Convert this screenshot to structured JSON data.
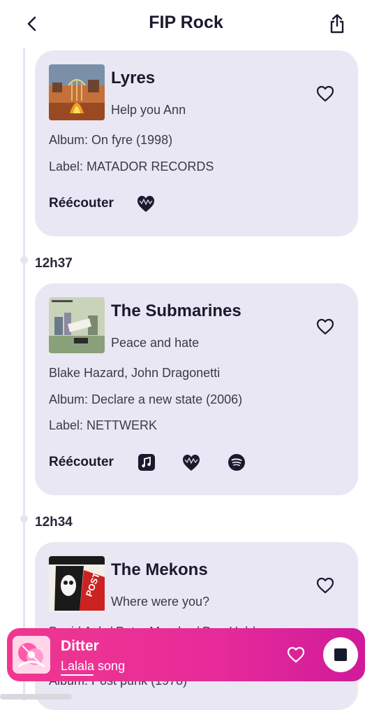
{
  "header": {
    "title": "FIP Rock"
  },
  "timeline": [
    {
      "time": "",
      "artist": "Lyres",
      "song": "Help you Ann",
      "meta": [
        "Album: On fyre (1998)",
        "Label: MATADOR RECORDS"
      ],
      "replay_label": "Réécouter",
      "services": [
        "deezer-icon"
      ]
    },
    {
      "time": "12h37",
      "artist": "The Submarines",
      "song": "Peace and hate",
      "meta": [
        "Blake Hazard, John Dragonetti",
        "Album: Declare a new state (2006)",
        "Label: NETTWERK"
      ],
      "replay_label": "Réécouter",
      "services": [
        "apple-music-icon",
        "deezer-icon",
        "spotify-icon"
      ]
    },
    {
      "time": "12h34",
      "artist": "The Mekons",
      "song": "Where were you?",
      "meta": [
        "David Ash / Peter Mender / Dan Hal /",
        "Album: Post punk (1978)"
      ]
    }
  ],
  "player": {
    "title": "Ditter",
    "subtitle": "Lalala song",
    "progress": 0.11
  },
  "colors": {
    "card": "#e9e7f3",
    "player_start": "#f0378f",
    "player_end": "#cf1a9a"
  }
}
